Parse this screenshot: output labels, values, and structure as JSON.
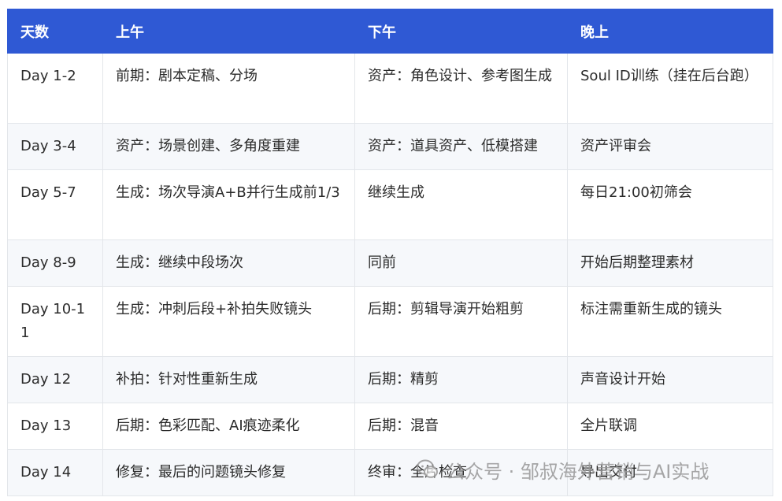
{
  "table": {
    "headers": [
      "天数",
      "上午",
      "下午",
      "晚上"
    ],
    "rows": [
      [
        "Day 1-2",
        "前期：剧本定稿、分场",
        "资产：角色设计、参考图生成",
        "Soul ID训练（挂在后台跑）"
      ],
      [
        "Day 3-4",
        "资产：场景创建、多角度重建",
        "资产：道具资产、低模搭建",
        "资产评审会"
      ],
      [
        "Day 5-7",
        "生成：场次导演A+B并行生成前1/3",
        "继续生成",
        "每日21:00初筛会"
      ],
      [
        "Day 8-9",
        "生成：继续中段场次",
        "同前",
        "开始后期整理素材"
      ],
      [
        "Day 10-11",
        "生成：冲刺后段+补拍失败镜头",
        "后期：剪辑导演开始粗剪",
        "标注需重新生成的镜头"
      ],
      [
        "Day 12",
        "补拍：针对性重新生成",
        "后期：精剪",
        "声音设计开始"
      ],
      [
        "Day 13",
        "后期：色彩匹配、AI痕迹柔化",
        "后期：混音",
        "全片联调"
      ],
      [
        "Day 14",
        "修复：最后的问题镜头修复",
        "终审：全片检查",
        "导出交付"
      ]
    ]
  },
  "watermark": {
    "text": "公众号 · 邹叔海外营销与AI实战",
    "icon": "wechat-icon"
  },
  "colors": {
    "header_bg": "#2f59d4",
    "header_text": "#ffffff",
    "alt_row_bg": "#f6f8fb",
    "border": "#e3e6ea"
  }
}
